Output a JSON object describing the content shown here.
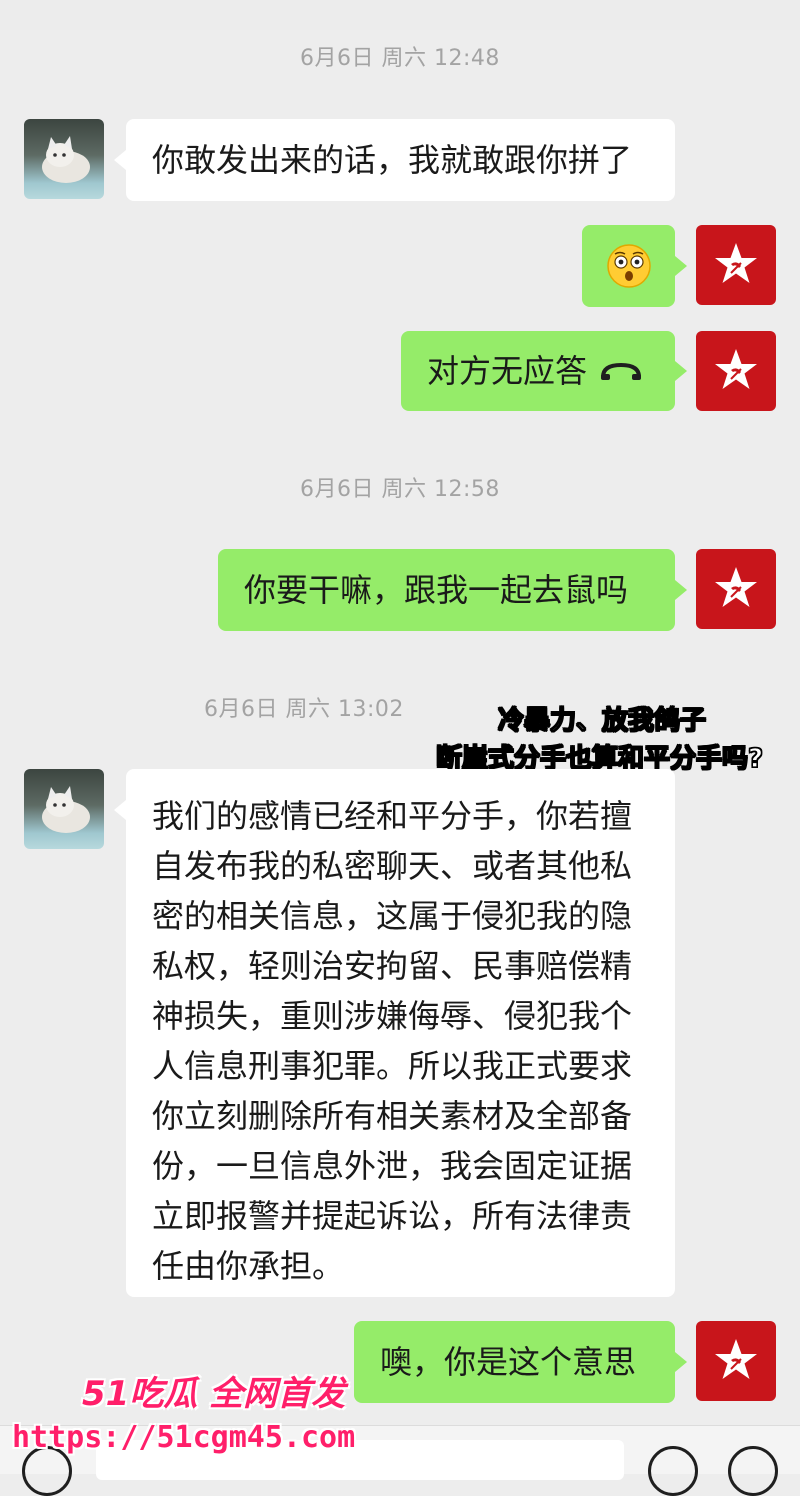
{
  "messages": {
    "ts1": "6月6日 周六 12:48",
    "m1": "你敢发出来的话，我就敢跟你拼了",
    "m3": "对方无应答",
    "ts2": "6月6日 周六 12:58",
    "m4": "你要干嘛，跟我一起去鼠吗",
    "ts3": "6月6日 周六 13:02",
    "m5_lines": [
      "我们的感情已经和平分手，你若擅",
      "自发布我的私密聊天、或者其他私",
      "密的相关信息，这属于侵犯我的隐",
      "私权，轻则治安拘留、民事赔偿精",
      "神损失，重则涉嫌侮辱、侵犯我个",
      "人信息刑事犯罪。所以我正式要求",
      "你立刻删除所有相关素材及全部备",
      "份，一旦信息外泄，我会固定证据",
      "立即报警并提起诉讼，所有法律责",
      "任由你承担。"
    ],
    "m6": "噢，你是这个意思"
  },
  "overlay": {
    "line1": "冷暴力、放我鸽子",
    "line2": "断崖式分手也算和平分手吗?"
  },
  "watermark": {
    "logo": "51吃瓜 全网首发",
    "url": "https://51cgm45.com"
  },
  "icons": {
    "emoji": "astonished-face",
    "call": "hangup-phone-icon",
    "avatar_right": "red-flag-star-avatar",
    "avatar_left": "white-cat-photo-avatar"
  },
  "colors": {
    "bg": "#ededed",
    "bubble_self": "#95ec69",
    "bubble_other": "#ffffff",
    "avatar_red": "#c8151b",
    "timestamp": "#a3a3a3",
    "watermark": "#ff1f6a"
  }
}
